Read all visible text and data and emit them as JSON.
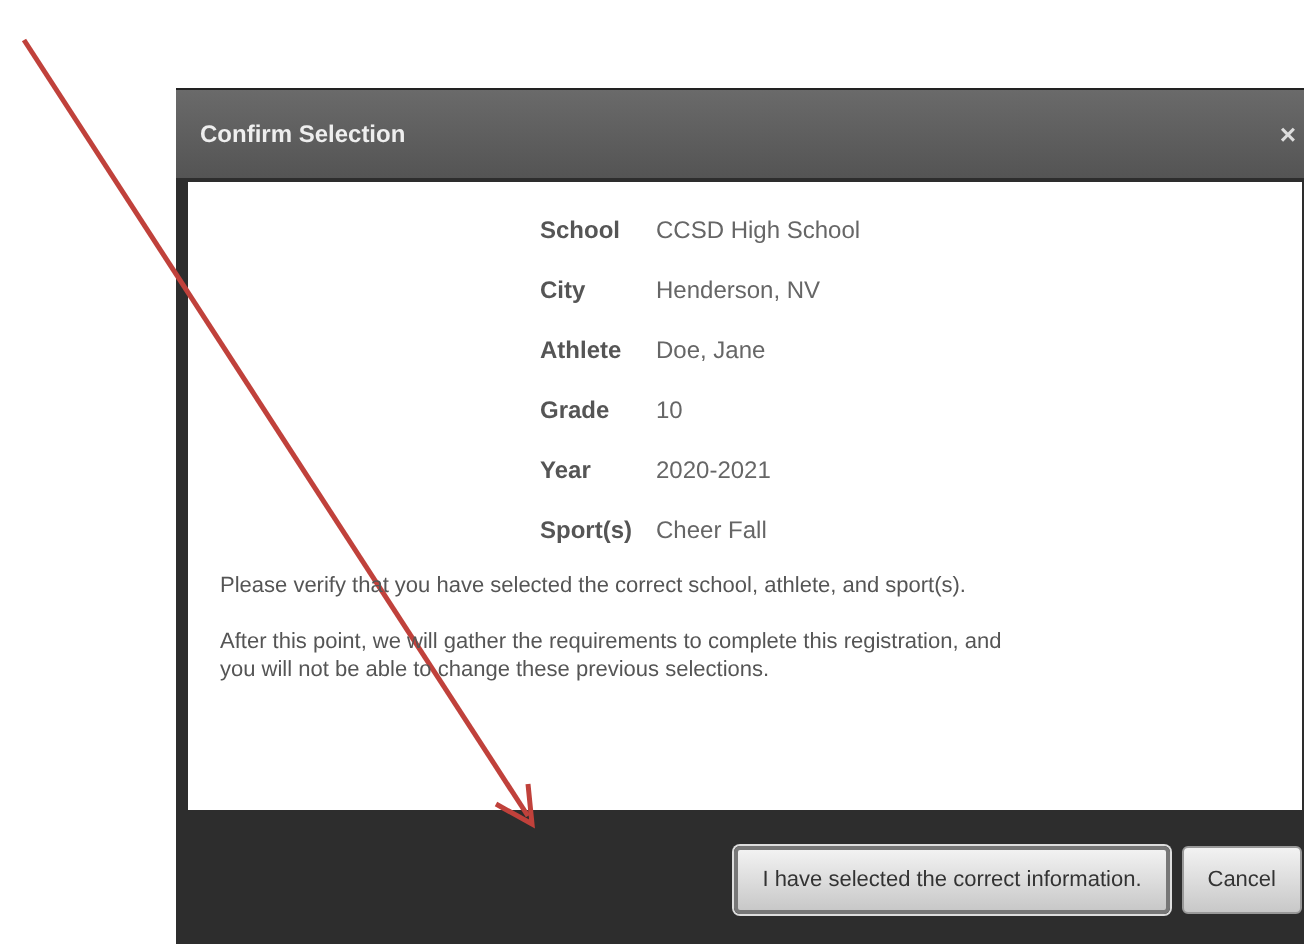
{
  "dialog": {
    "title": "Confirm Selection",
    "close": "×",
    "details": [
      {
        "label": "School",
        "value": "CCSD High School"
      },
      {
        "label": "City",
        "value": "Henderson, NV"
      },
      {
        "label": "Athlete",
        "value": "Doe, Jane"
      },
      {
        "label": "Grade",
        "value": "10"
      },
      {
        "label": "Year",
        "value": "2020-2021"
      },
      {
        "label": "Sport(s)",
        "value": "Cheer Fall"
      }
    ],
    "paragraphs": [
      "Please verify that you have selected the correct school, athlete, and sport(s).",
      "After this point, we will gather the requirements to complete this registration, and you will not be able to change these previous selections."
    ],
    "buttons": [
      {
        "label": "I have selected the correct information.",
        "kind": "primary"
      },
      {
        "label": "Cancel",
        "kind": "secondary"
      }
    ]
  }
}
